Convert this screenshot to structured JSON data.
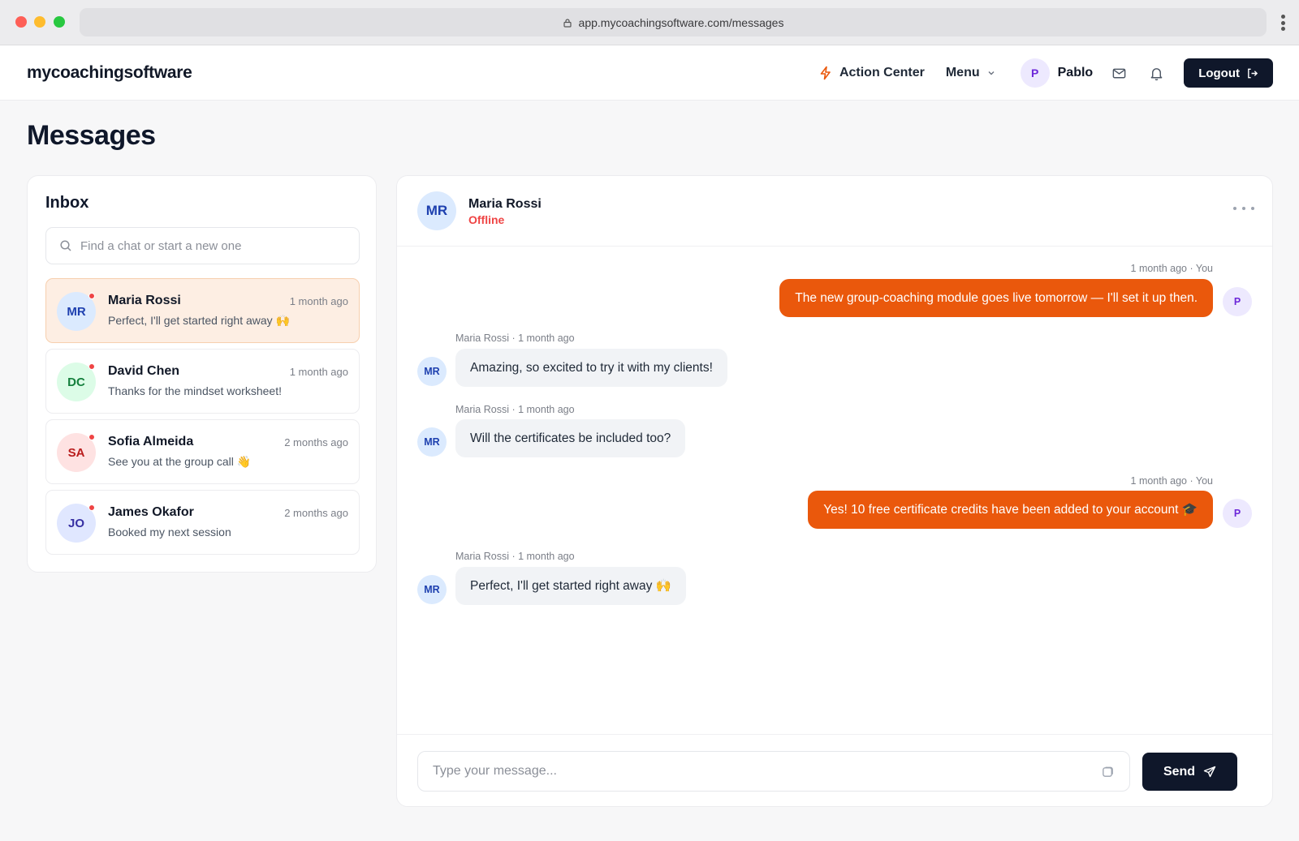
{
  "browser": {
    "url": "app.mycoachingsoftware.com/messages"
  },
  "header": {
    "brand": "mycoachingsoftware",
    "action_center_label": "Action Center",
    "menu_label": "Menu",
    "user_initial": "P",
    "user_name": "Pablo",
    "logout_label": "Logout"
  },
  "page": {
    "title": "Messages"
  },
  "inbox": {
    "title": "Inbox",
    "search_placeholder": "Find a chat or start a new one",
    "chats": [
      {
        "initials": "MR",
        "name": "Maria Rossi",
        "time": "1 month ago",
        "preview": "Perfect, I'll get started right away 🙌",
        "avatar_bg": "#dbeafe",
        "avatar_fg": "#1e40af",
        "active": true
      },
      {
        "initials": "DC",
        "name": "David Chen",
        "time": "1 month ago",
        "preview": "Thanks for the mindset worksheet!",
        "avatar_bg": "#dcfce7",
        "avatar_fg": "#15803d",
        "active": false
      },
      {
        "initials": "SA",
        "name": "Sofia Almeida",
        "time": "2 months ago",
        "preview": "See you at the group call 👋",
        "avatar_bg": "#fee2e2",
        "avatar_fg": "#b91c1c",
        "active": false
      },
      {
        "initials": "JO",
        "name": "James Okafor",
        "time": "2 months ago",
        "preview": "Booked my next session",
        "avatar_bg": "#e0e7ff",
        "avatar_fg": "#3730a3",
        "active": false
      }
    ]
  },
  "conversation": {
    "contact_initials": "MR",
    "contact_name": "Maria Rossi",
    "contact_status": "Offline",
    "messages": [
      {
        "direction": "out",
        "meta": "1 month ago · You",
        "text": "The new group-coaching module goes live tomorrow — I'll set it up then.",
        "avatar": "P"
      },
      {
        "direction": "in",
        "meta": "Maria Rossi · 1 month ago",
        "text": "Amazing, so excited to try it with my clients!",
        "avatar": "MR"
      },
      {
        "direction": "in",
        "meta": "Maria Rossi · 1 month ago",
        "text": "Will the certificates be included too?",
        "avatar": "MR"
      },
      {
        "direction": "out",
        "meta": "1 month ago · You",
        "text": "Yes! 10 free certificate credits have been added to your account 🎓",
        "avatar": "P"
      },
      {
        "direction": "in",
        "meta": "Maria Rossi · 1 month ago",
        "text": "Perfect, I'll get started right away 🙌",
        "avatar": "MR"
      }
    ],
    "input_placeholder": "Type your message...",
    "send_label": "Send"
  },
  "colors": {
    "accent": "#ea580c",
    "dark_button": "#0f172a",
    "status_offline": "#ef4444",
    "unread_dot": "#ef4444"
  },
  "icons": {
    "lock": "lock-icon",
    "action_center": "lightning-icon",
    "menu": "chevron-down-icon",
    "mail": "mail-icon",
    "bell": "bell-icon",
    "logout": "logout-icon",
    "search": "search-icon",
    "more": "more-horizontal-icon",
    "attach": "attachment-icon",
    "send": "send-icon"
  }
}
